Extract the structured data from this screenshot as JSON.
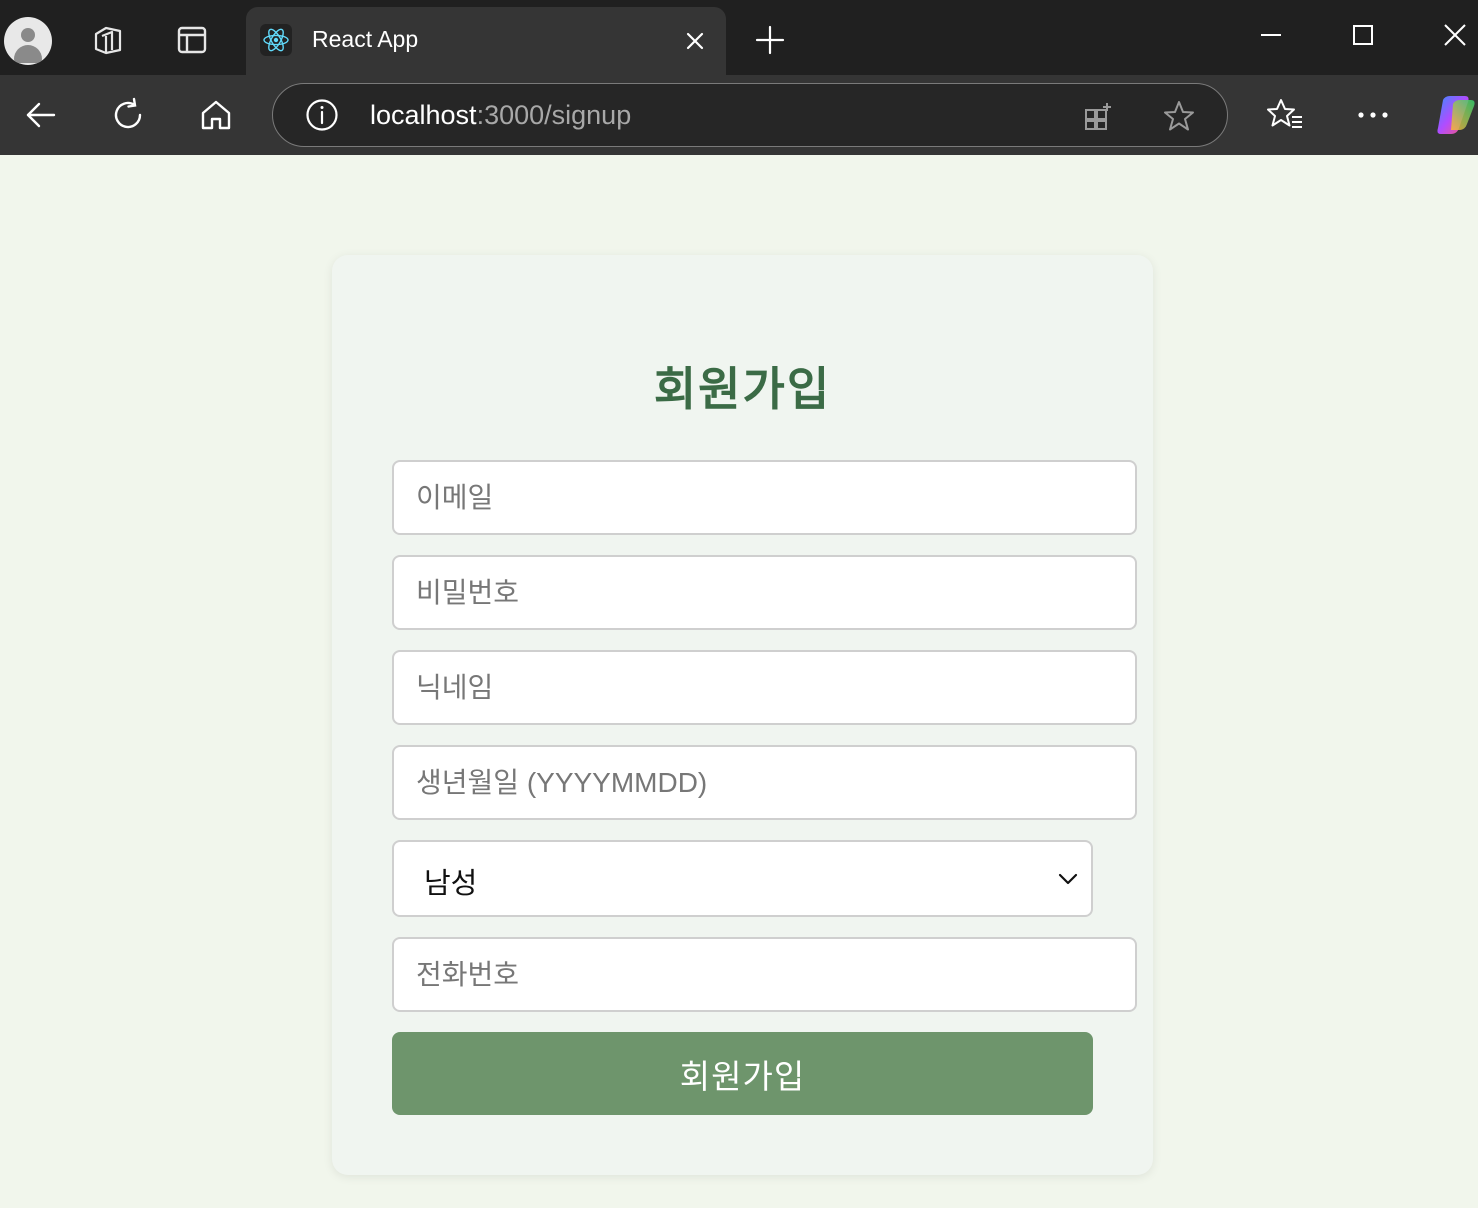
{
  "browser": {
    "tab": {
      "title": "React App",
      "favicon": "react-logo-icon"
    },
    "address": {
      "host": "localhost",
      "path": ":3000/signup"
    },
    "icons": {
      "workspaces": "workspaces-icon",
      "tab_actions": "tab-actions-icon",
      "new_tab": "plus-icon",
      "minimize": "minimize-icon",
      "maximize": "maximize-icon",
      "close": "close-icon",
      "back": "back-arrow-icon",
      "refresh": "refresh-icon",
      "home": "home-icon",
      "site_info": "info-icon",
      "apps": "add-app-icon",
      "favorite": "star-icon",
      "favorites": "favorites-icon",
      "more": "more-icon",
      "copilot": "copilot-icon"
    }
  },
  "signup": {
    "title": "회원가입",
    "email_placeholder": "이메일",
    "password_placeholder": "비밀번호",
    "nickname_placeholder": "닉네임",
    "birthdate_placeholder": "생년월일 (YYYYMMDD)",
    "gender_selected": "남성",
    "phone_placeholder": "전화번호",
    "submit_label": "회원가입"
  },
  "colors": {
    "page_bg": "#f1f6ec",
    "card_bg": "#f0f5f0",
    "heading": "#3b6b46",
    "button": "#6e956c"
  }
}
